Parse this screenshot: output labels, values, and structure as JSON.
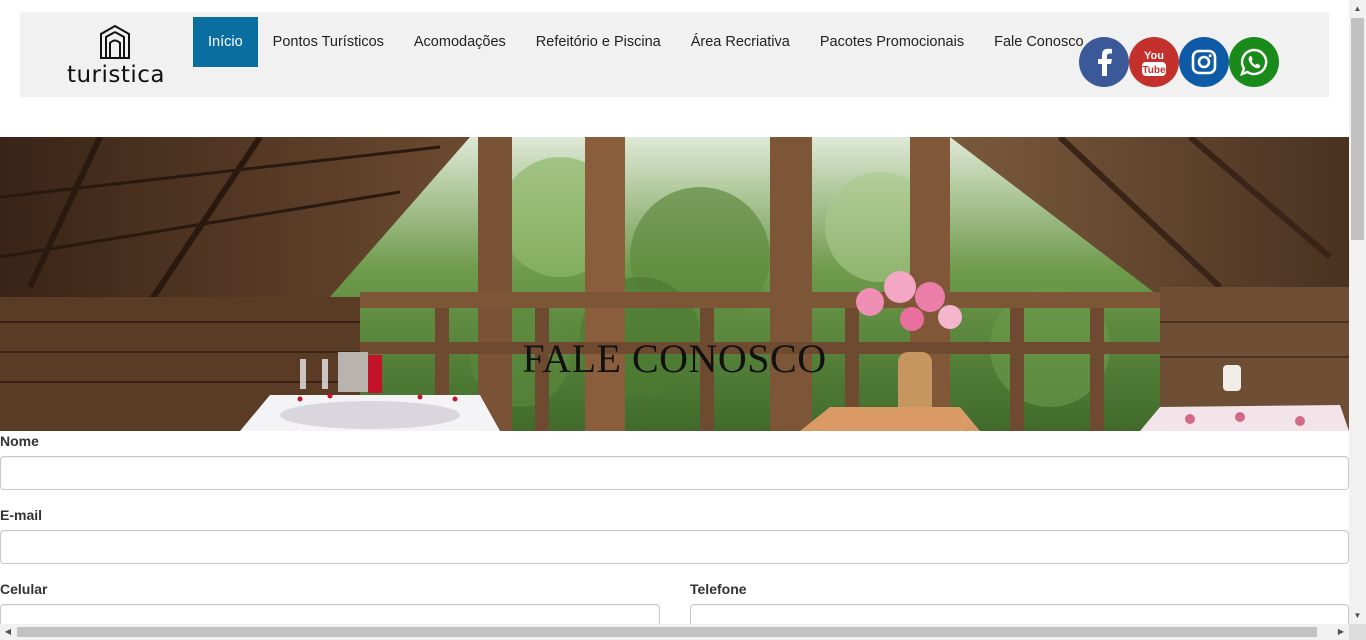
{
  "brand": {
    "name": "turistica"
  },
  "nav": {
    "items": [
      {
        "label": "Início",
        "active": true
      },
      {
        "label": "Pontos Turísticos",
        "active": false
      },
      {
        "label": "Acomodações",
        "active": false
      },
      {
        "label": "Refeitório e Piscina",
        "active": false
      },
      {
        "label": "Área Recriativa",
        "active": false
      },
      {
        "label": "Pacotes Promocionais",
        "active": false
      },
      {
        "label": "Fale Conosco",
        "active": false
      }
    ]
  },
  "social": [
    {
      "icon": "facebook-icon",
      "color": "#3b5998"
    },
    {
      "icon": "youtube-icon",
      "color": "#c4302b"
    },
    {
      "icon": "instagram-icon",
      "color": "#0e5aa7"
    },
    {
      "icon": "whatsapp-icon",
      "color": "#1a8a1a"
    }
  ],
  "hero": {
    "title": "FALE CONOSCO"
  },
  "form": {
    "nome": {
      "label": "Nome",
      "value": "",
      "placeholder": ""
    },
    "email": {
      "label": "E-mail",
      "value": "",
      "placeholder": ""
    },
    "celular": {
      "label": "Celular",
      "value": "",
      "placeholder": ""
    },
    "telefone": {
      "label": "Telefone",
      "value": "",
      "placeholder": ""
    }
  },
  "colors": {
    "accent": "#0a6fa0",
    "navbar_bg": "#f1f1f1"
  }
}
